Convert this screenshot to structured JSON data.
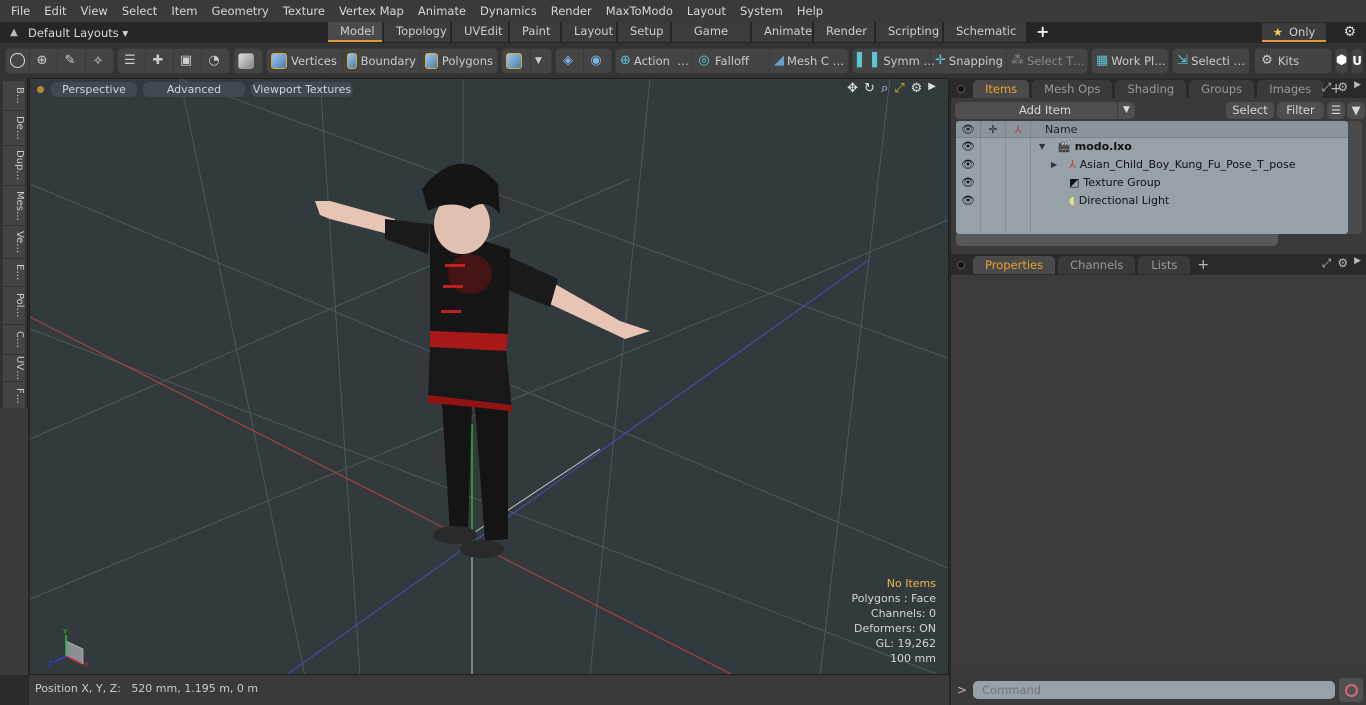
{
  "menu": [
    "File",
    "Edit",
    "View",
    "Select",
    "Item",
    "Geometry",
    "Texture",
    "Vertex Map",
    "Animate",
    "Dynamics",
    "Render",
    "MaxToModo",
    "Layout",
    "System",
    "Help"
  ],
  "layoutbar": {
    "default_layouts": "Default Layouts ▾",
    "tabs": [
      "Model",
      "Topology",
      "UVEdit",
      "Paint",
      "Layout",
      "Setup",
      "Game Tools",
      "Animate",
      "Render",
      "Scripting",
      "Schematic Fusion"
    ],
    "active_tab": "Model",
    "add_tab": "+",
    "only_label": "Only",
    "accent_color": "#e09a3a"
  },
  "toolbar": {
    "vertices": "Vertices",
    "boundary": "Boundary",
    "polygons": "Polygons",
    "action": "Action",
    "action_more": "…",
    "falloff": "Falloff",
    "mesh_c": "Mesh C …",
    "symm": "Symm …",
    "snapping": "Snapping",
    "select_t": "Select T…",
    "work_pl": "Work Pl…",
    "selecti": "Selecti …",
    "kits": "Kits"
  },
  "left_strip": [
    "B…",
    "De…",
    "Dup…",
    "Mes…",
    "Ve…",
    "E…",
    "Pol…",
    "C…",
    "UV…",
    "F…"
  ],
  "viewport": {
    "view_mode": "Perspective",
    "shading": "Advanced",
    "textures": "Viewport Textures",
    "info": {
      "selection": "No Items",
      "polygons": "Polygons : Face",
      "channels": "Channels: 0",
      "deformers": "Deformers: ON",
      "gl": "GL: 19,262",
      "scale": "100 mm"
    },
    "axis_labels": {
      "x": "X",
      "y": "Y",
      "z": "Z"
    }
  },
  "statusbar": {
    "position_label": "Position X, Y, Z:",
    "position_value": "520 mm, 1.195 m, 0 m"
  },
  "items_panel": {
    "tabs": [
      "Items",
      "Mesh Ops",
      "Shading",
      "Groups",
      "Images"
    ],
    "active_tab": "Items",
    "add_item": "Add Item",
    "select": "Select",
    "filter": "Filter",
    "name_header": "Name",
    "tree": [
      {
        "name": "modo.lxo",
        "level": 0,
        "bold": true,
        "icon": "scene-clapper-icon",
        "expand": "▼"
      },
      {
        "name": "Asian_Child_Boy_Kung_Fu_Pose_T_pose",
        "level": 1,
        "icon": "mesh-locator-icon",
        "expand": "▶"
      },
      {
        "name": "Texture Group",
        "level": 1,
        "icon": "texture-group-icon",
        "expand": ""
      },
      {
        "name": "Directional Light",
        "level": 1,
        "icon": "light-icon",
        "expand": ""
      }
    ]
  },
  "properties_panel": {
    "tabs": [
      "Properties",
      "Channels",
      "Lists"
    ],
    "active_tab": "Properties"
  },
  "command": {
    "prompt": ">",
    "placeholder": "Command"
  }
}
